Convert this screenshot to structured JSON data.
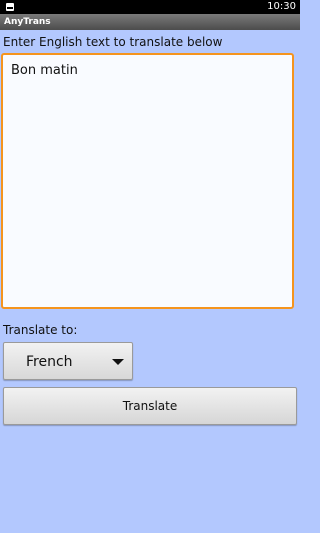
{
  "status_bar": {
    "time": "10:30",
    "notification_icon": "notification-icon"
  },
  "app": {
    "title": "AnyTrans"
  },
  "main": {
    "prompt": "Enter English text to translate below",
    "input_text": "Bon matin",
    "translate_to_label": "Translate to:",
    "language_select": {
      "selected": "French",
      "icon": "dropdown-caret-icon"
    },
    "translate_button": "Translate"
  },
  "colors": {
    "background": "#b3c8fe",
    "text_area_border": "#f5941e",
    "text_area_bg": "#f9fbff"
  }
}
